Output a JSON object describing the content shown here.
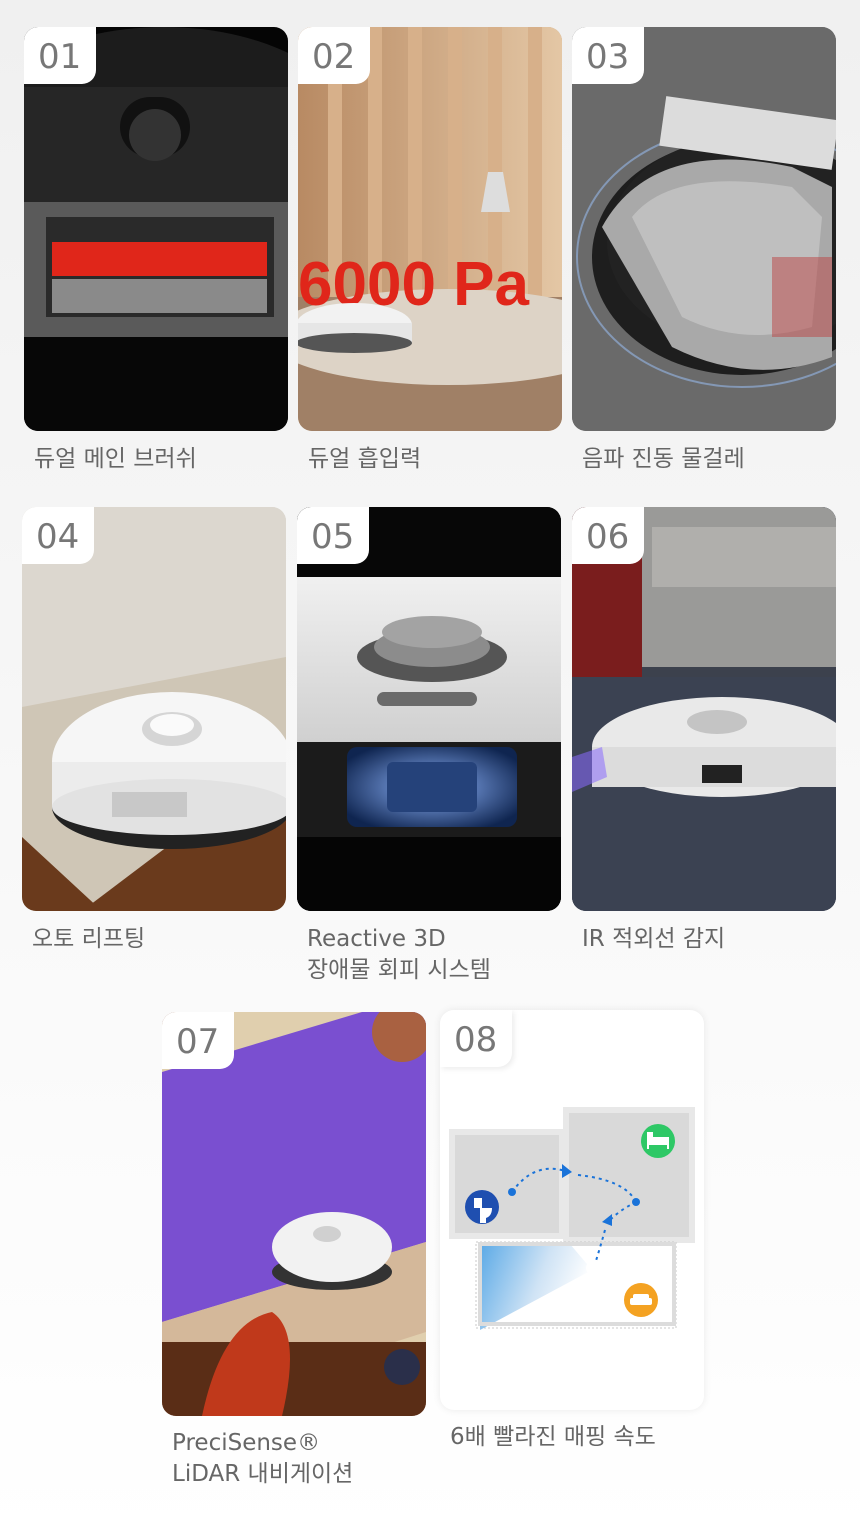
{
  "features": [
    {
      "num": "01",
      "caption": "듀얼 메인 브러쉬"
    },
    {
      "num": "02",
      "caption": "듀얼 흡입력",
      "overlay": "6000 Pa"
    },
    {
      "num": "03",
      "caption": "음파 진동 물걸레"
    },
    {
      "num": "04",
      "caption": "오토 리프팅"
    },
    {
      "num": "05",
      "caption_line1": "Reactive 3D",
      "caption_line2": "장애물 회피 시스템"
    },
    {
      "num": "06",
      "caption": "IR 적외선 감지"
    },
    {
      "num": "07",
      "caption_line1": "PreciSense®",
      "caption_line2": "LiDAR 내비게이션"
    },
    {
      "num": "08",
      "caption": "6배 빨라진 매핑 속도"
    }
  ],
  "colors": {
    "accent_red": "#e0261a",
    "bed_green": "#2ec866",
    "toilet_blue": "#1f4fb0",
    "sofa_orange": "#f4a222",
    "path_blue": "#1a73d9",
    "lidar_purple": "#7a4fd0"
  },
  "icons": [
    "toilet-icon",
    "bed-icon",
    "sofa-icon"
  ]
}
